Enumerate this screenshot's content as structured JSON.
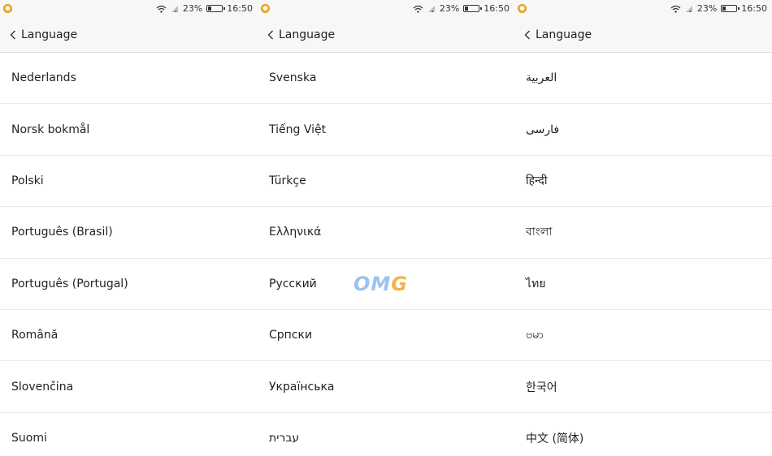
{
  "status_bar": {
    "battery": "23%",
    "time": "16:50"
  },
  "header": {
    "title": "Language"
  },
  "screens": [
    {
      "items": [
        "Nederlands",
        "Norsk bokmål",
        "Polski",
        "Português (Brasil)",
        "Português (Portugal)",
        "Română",
        "Slovenčina",
        "Suomi"
      ]
    },
    {
      "items": [
        "Svenska",
        "Tiếng Việt",
        "Türkçe",
        "Ελληνικά",
        "Русский",
        "Српски",
        "Українська",
        "עברית"
      ]
    },
    {
      "items": [
        "العربية",
        "فارسی",
        "हिन्दी",
        "বাংলা",
        "ไทย",
        "ဗမာ",
        "한국어",
        "中文 (简体)"
      ]
    }
  ],
  "watermark": {
    "text_a": "OM",
    "text_b": "G"
  }
}
